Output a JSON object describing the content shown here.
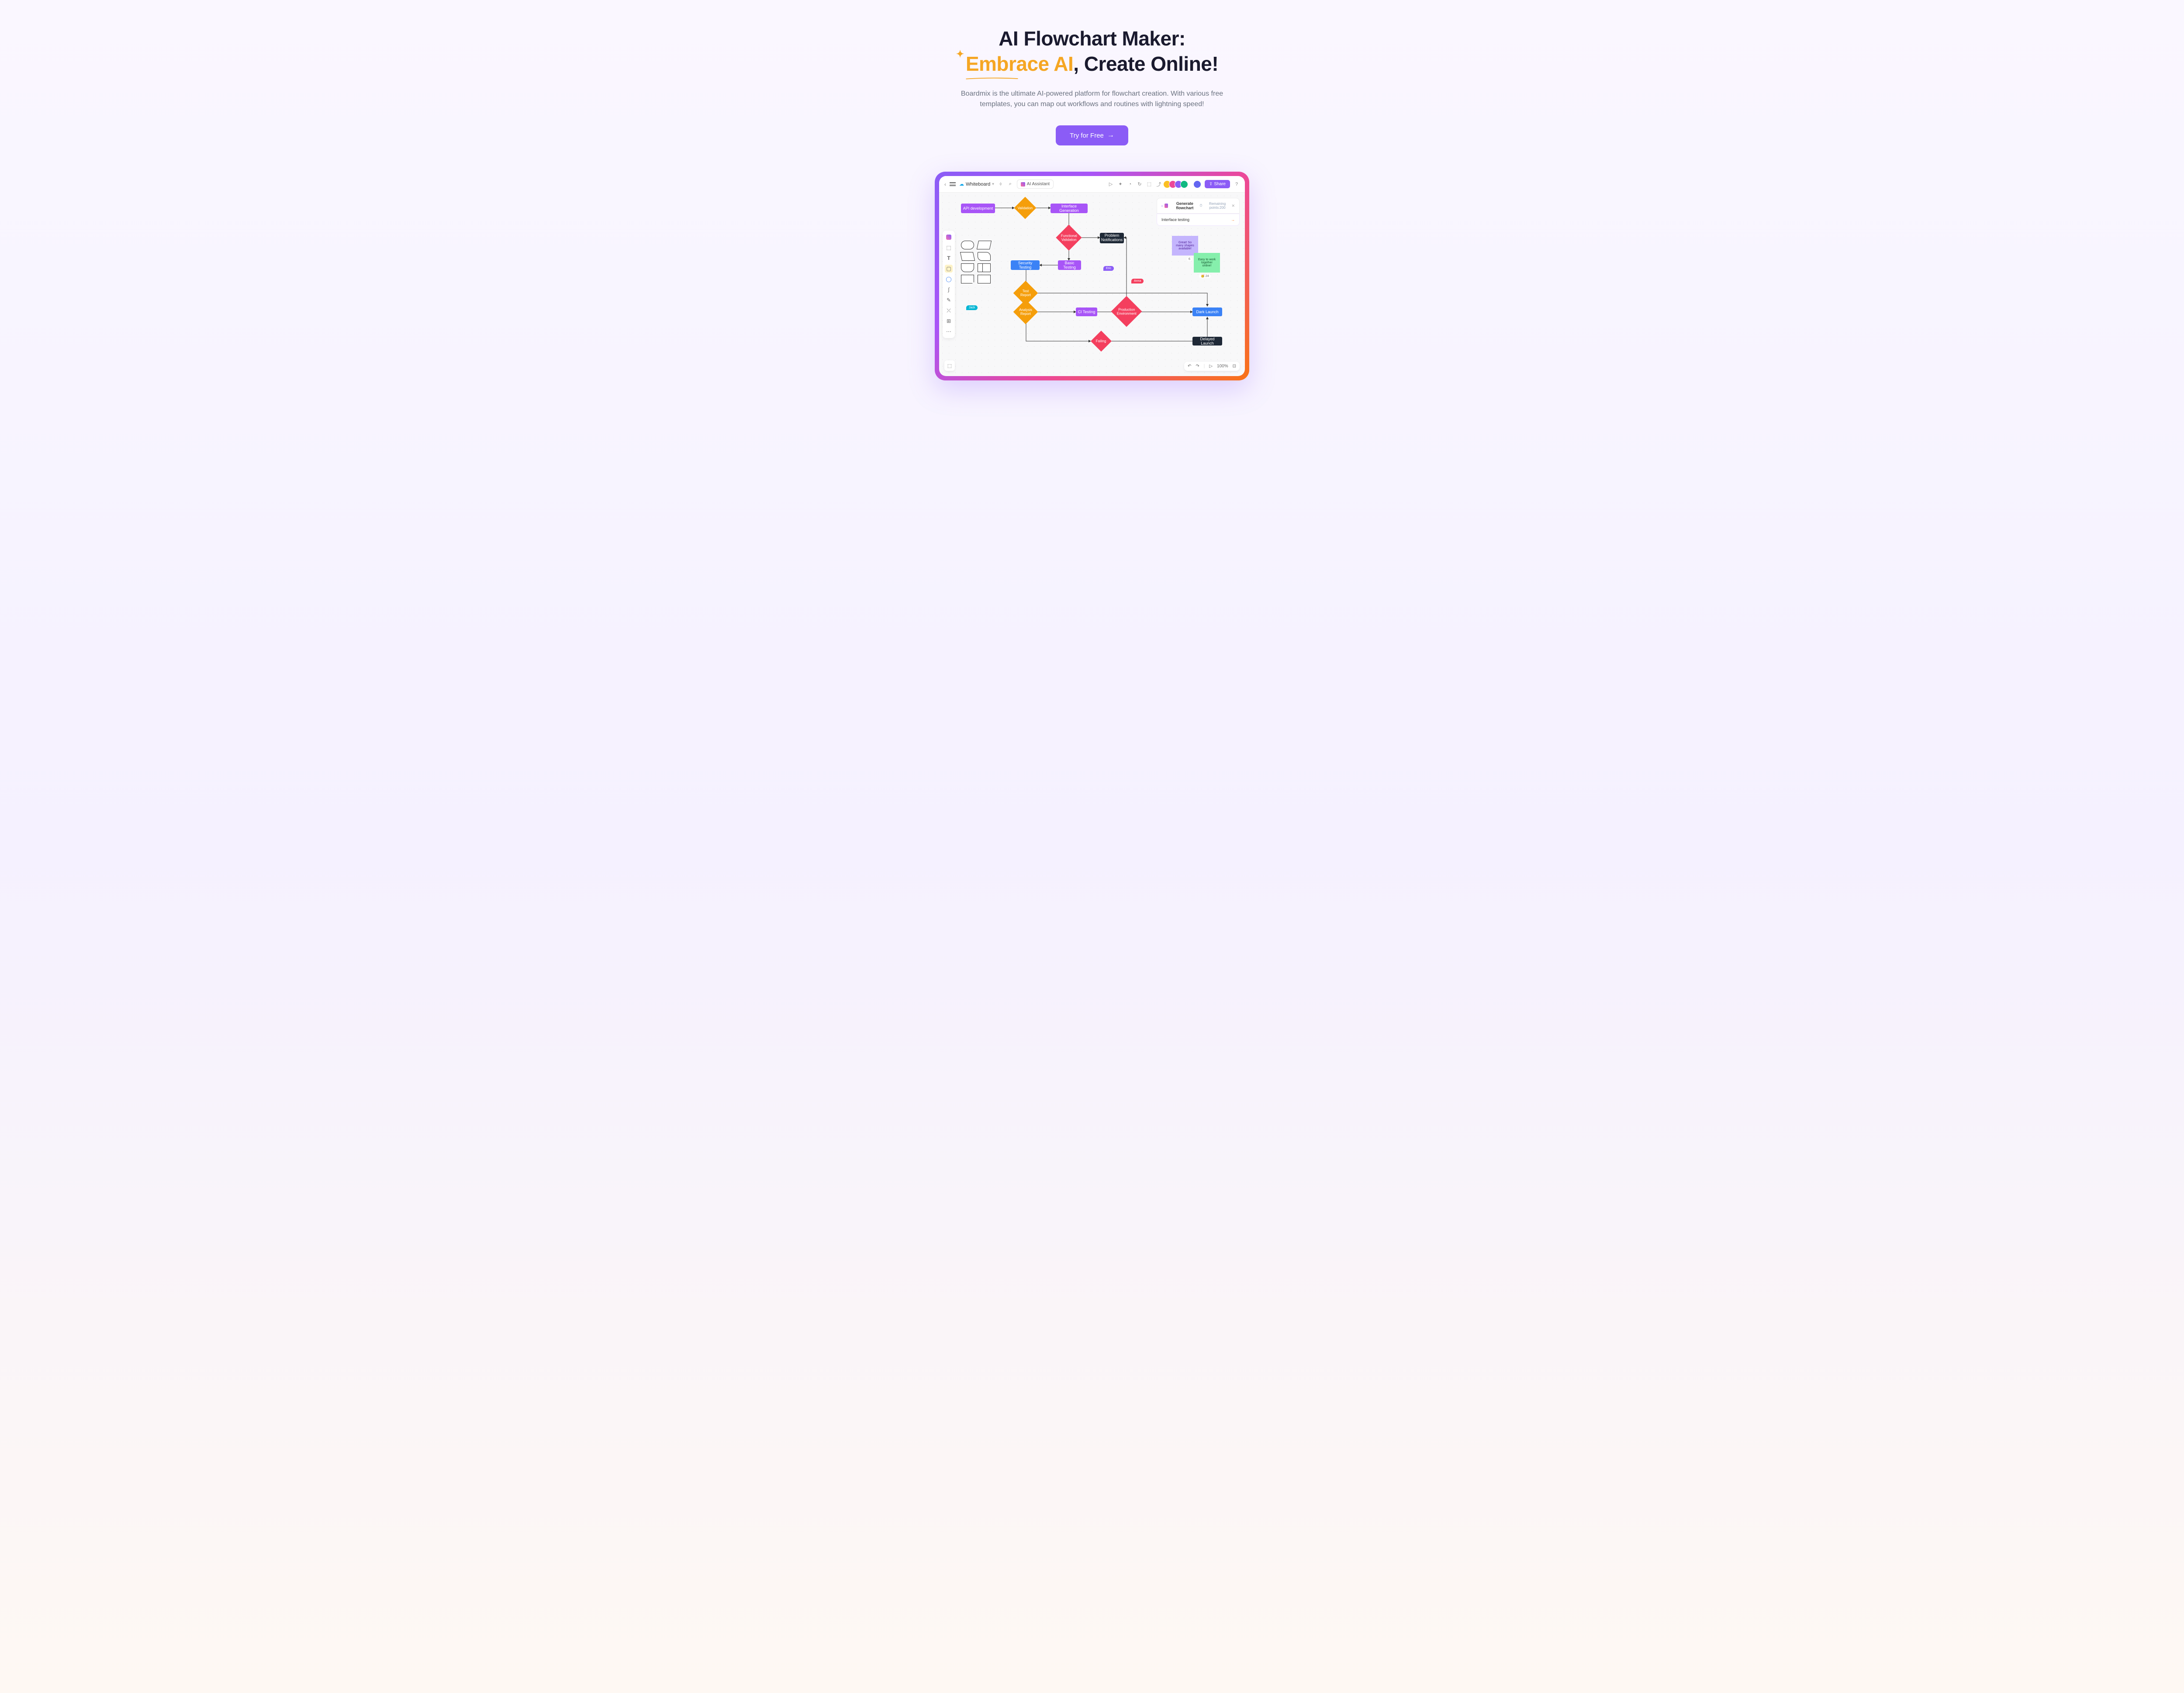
{
  "hero": {
    "title_line1": "AI Flowchart Maker:",
    "title_highlight": "Embrace AI",
    "title_line2": ", Create Online!",
    "subtitle": "Boardmix is the ultimate AI-powered platform for flowchart creation. With various free templates, you can map out workflows and routines with lightning speed!",
    "cta": "Try for Free"
  },
  "topbar": {
    "whiteboard": "Whiteboard",
    "ai_assistant": "AI Assistant",
    "share": "Share"
  },
  "ai_panel": {
    "title": "Generate flowchart",
    "points": "Remaining points:200",
    "input": "Interface testing"
  },
  "nodes": {
    "api": "API development",
    "validation": "Validation",
    "interface_gen": "Interface Generation",
    "functional": "Functional Validation",
    "problem": "Problem Notifications",
    "security": "Security Testing",
    "basic": "Basic Testing",
    "test_report": "Test Report",
    "analysis": "Analysis Report",
    "ci": "CI Testing",
    "production": "Production Environment",
    "dark_launch": "Dark Launch",
    "failing": "Failing",
    "delayed": "Delayed Launch"
  },
  "stickies": {
    "note1": "Great! So many shapes available!",
    "note2": "Easy to work together online!",
    "count1": "6",
    "count2": "24"
  },
  "cursors": {
    "jack": "Jack",
    "eric": "Eric",
    "anna": "Anna"
  },
  "zoom": "100%"
}
